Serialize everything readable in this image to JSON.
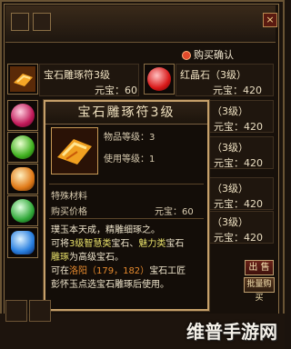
{
  "header": {
    "buy_confirm": "购买确认",
    "close": "×"
  },
  "items": [
    {
      "name": "宝石雕琢符3级",
      "price": "元宝：60",
      "gem": "scroll-icon"
    },
    {
      "name": "红晶石（3级）",
      "price": "元宝：420",
      "gem": "ruby-gem-icon"
    },
    {
      "name": "",
      "price": "",
      "gem": "pink-gem-icon"
    },
    {
      "name": "（3级）",
      "price": "元宝：420",
      "gem": "green-gem-icon"
    },
    {
      "name": "（3级）",
      "price": "元宝：420",
      "gem": "orange-gem-icon"
    },
    {
      "name": "（3级）",
      "price": "元宝：420",
      "gem": "blue-gem-icon"
    },
    {
      "name": "（3级）",
      "price": "元宝：420",
      "gem": "sapphire-gem-icon"
    }
  ],
  "tooltip": {
    "title": "宝石雕琢符3级",
    "item_level": "物品等级：3",
    "use_level": "使用等级：1",
    "special": "特殊材料",
    "buy_price_label": "购买价格",
    "buy_price": "元宝：60",
    "desc_line1": "璞玉本天成，精雕细琢之。",
    "desc_line2a": "可将",
    "desc_line2b": "3级智慧类",
    "desc_line2c": "宝石、",
    "desc_line2d": "魅力类",
    "desc_line2e": "宝石",
    "desc_line3a": "雕琢",
    "desc_line3b": "为高级宝石。",
    "desc_line4a": "可在",
    "desc_line4b": "洛阳（179，182）",
    "desc_line4c": "宝石工匠",
    "desc_line5": "彭怀玉点选宝石雕琢后使用。"
  },
  "buttons": {
    "sell": "出 售",
    "bulk_buy": "批量购买"
  },
  "watermark": "维普手游网"
}
